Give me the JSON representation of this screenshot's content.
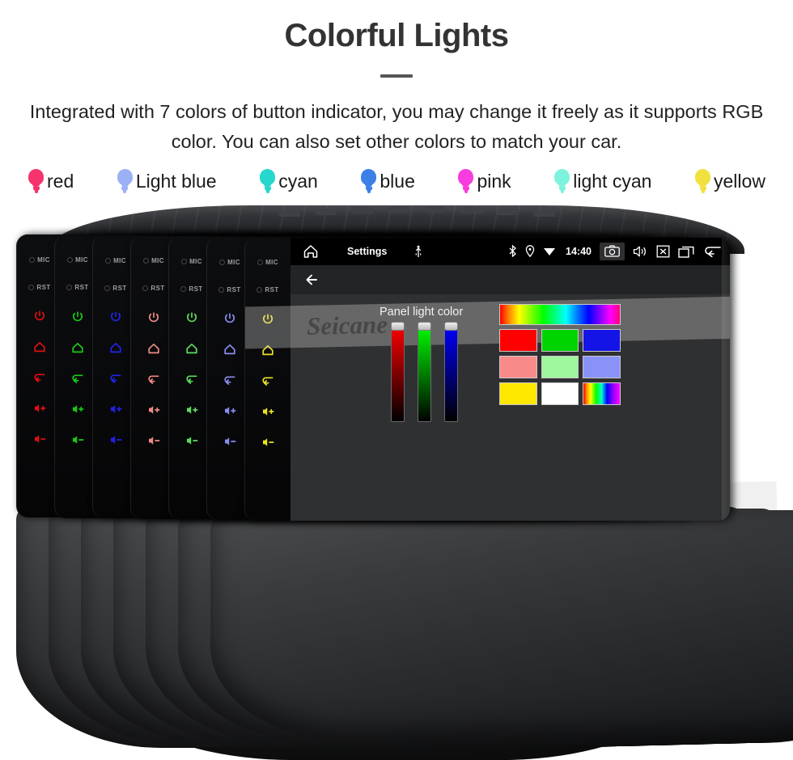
{
  "header": {
    "title": "Colorful Lights",
    "subtitle": "Integrated with 7 colors of button indicator, you may change it freely as it supports RGB color. You can also set other colors to match your car."
  },
  "legend": {
    "items": [
      {
        "label": "red",
        "color": "#f6336c",
        "icon": "bulb-icon"
      },
      {
        "label": "Light blue",
        "color": "#9bb1f5",
        "icon": "bulb-icon"
      },
      {
        "label": "cyan",
        "color": "#25d7cd",
        "icon": "bulb-icon"
      },
      {
        "label": "blue",
        "color": "#3d7fe8",
        "icon": "bulb-icon"
      },
      {
        "label": "pink",
        "color": "#f73ddd",
        "icon": "bulb-icon"
      },
      {
        "label": "light cyan",
        "color": "#7df3de",
        "icon": "bulb-icon"
      },
      {
        "label": "yellow",
        "color": "#f0e13f",
        "icon": "bulb-icon"
      }
    ]
  },
  "device": {
    "brand_watermark": "Seicane",
    "panels": [
      {
        "color": "#e01010",
        "name": "panel-red"
      },
      {
        "color": "#16cc16",
        "name": "panel-green"
      },
      {
        "color": "#2222e8",
        "name": "panel-blue"
      },
      {
        "color": "#ef8a86",
        "name": "panel-salmon"
      },
      {
        "color": "#5ddb5d",
        "name": "panel-light-green"
      },
      {
        "color": "#8a8cf2",
        "name": "panel-periwinkle"
      },
      {
        "color": "#ece327",
        "name": "panel-yellow"
      }
    ],
    "buttons": {
      "mic_label": "MIC",
      "rst_label": "RST",
      "power": "power-icon",
      "home": "home-icon",
      "back": "back-icon",
      "volume_up": "volume-up-icon",
      "volume_down": "volume-down-icon"
    }
  },
  "screen": {
    "statusbar": {
      "home_icon": "home-icon",
      "title": "Settings",
      "usb_icon": "usb-icon",
      "bluetooth_icon": "bluetooth-icon",
      "location_icon": "location-icon",
      "wifi_icon": "wifi-icon",
      "clock": "14:40",
      "screenshot_icon": "camera-icon",
      "volume_icon": "volume-icon",
      "close_icon": "close-box-icon",
      "recents_icon": "recents-icon",
      "back_icon": "back-arrow-icon"
    },
    "actionbar": {
      "back_icon": "arrow-left-icon"
    },
    "dialog": {
      "title": "Panel light color",
      "sliders": [
        {
          "name": "red-slider",
          "channel": "R",
          "color": "#ff0000",
          "value": 100
        },
        {
          "name": "green-slider",
          "channel": "G",
          "color": "#00ff00",
          "value": 100
        },
        {
          "name": "blue-slider",
          "channel": "B",
          "color": "#0000ff",
          "value": 100
        }
      ],
      "spectrum_label": "color-spectrum-bar",
      "swatches": [
        [
          {
            "color": "#ff0000",
            "name": "swatch-red"
          },
          {
            "color": "#00d400",
            "name": "swatch-green"
          },
          {
            "color": "#1414e6",
            "name": "swatch-blue"
          }
        ],
        [
          {
            "color": "#f98a8a",
            "name": "swatch-salmon"
          },
          {
            "color": "#9df79d",
            "name": "swatch-light-green"
          },
          {
            "color": "#8a92f7",
            "name": "swatch-periwinkle"
          }
        ],
        [
          {
            "color": "#ffe800",
            "name": "swatch-yellow"
          },
          {
            "color": "#ffffff",
            "name": "swatch-white"
          },
          {
            "color": "rainbow",
            "name": "swatch-rainbow"
          }
        ]
      ]
    }
  }
}
